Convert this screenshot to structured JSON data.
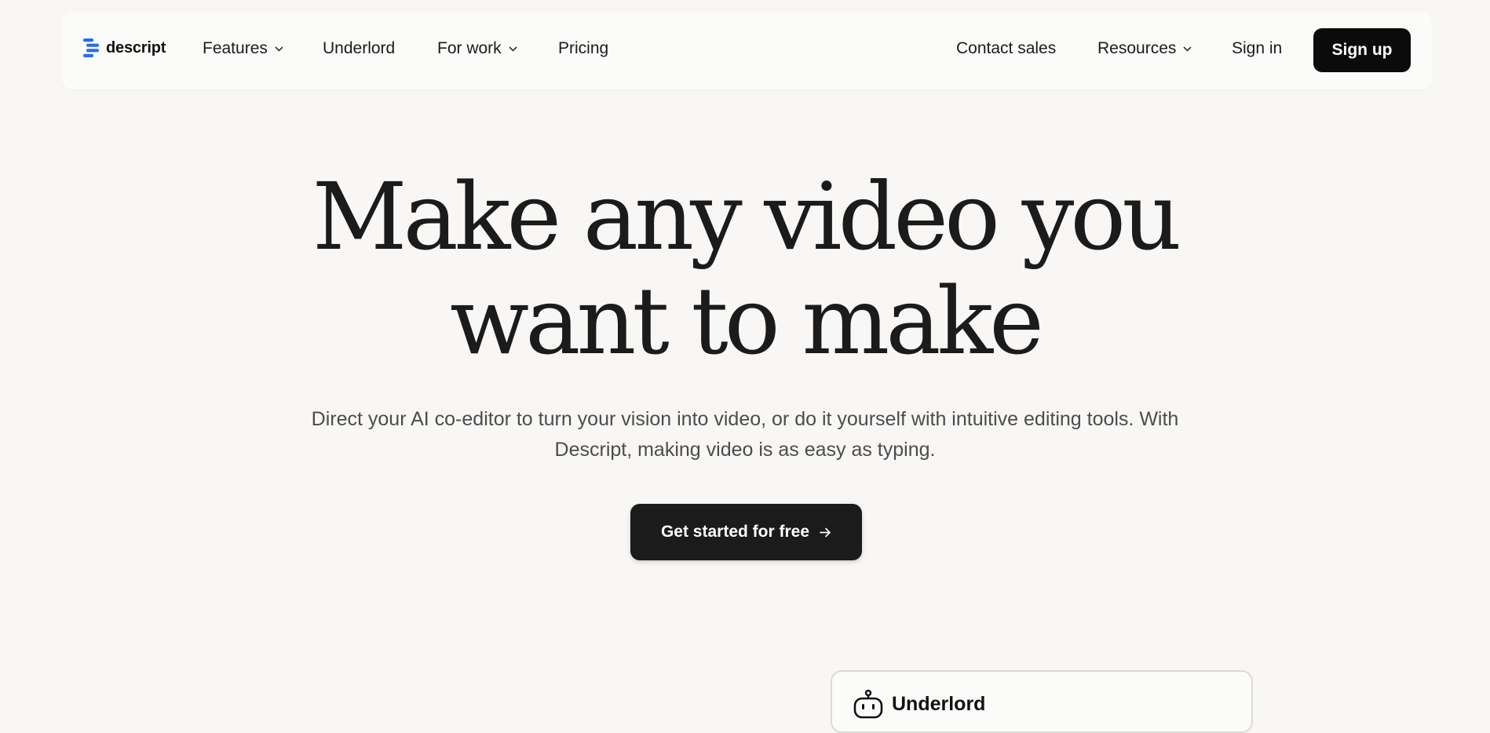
{
  "brand": {
    "name": "descript",
    "accent": "#2a6ee8"
  },
  "nav": {
    "left": [
      {
        "label": "Features",
        "dropdown": true
      },
      {
        "label": "Underlord",
        "dropdown": false
      },
      {
        "label": "For work",
        "dropdown": true
      },
      {
        "label": "Pricing",
        "dropdown": false
      }
    ],
    "right": [
      {
        "label": "Contact sales",
        "dropdown": false
      },
      {
        "label": "Resources",
        "dropdown": true
      },
      {
        "label": "Sign in",
        "dropdown": false
      }
    ],
    "signup_label": "Sign up"
  },
  "hero": {
    "headline_line1": "Make any video you",
    "headline_line2": "want to make",
    "subtext": "Direct your AI co-editor to turn your vision into video, or do it yourself with intuitive editing tools. With Descript, making video is as easy as typing.",
    "cta_label": "Get started for free",
    "cta_icon": "arrow-right-icon"
  },
  "preview_card": {
    "title": "Underlord",
    "icon": "robot-icon"
  }
}
